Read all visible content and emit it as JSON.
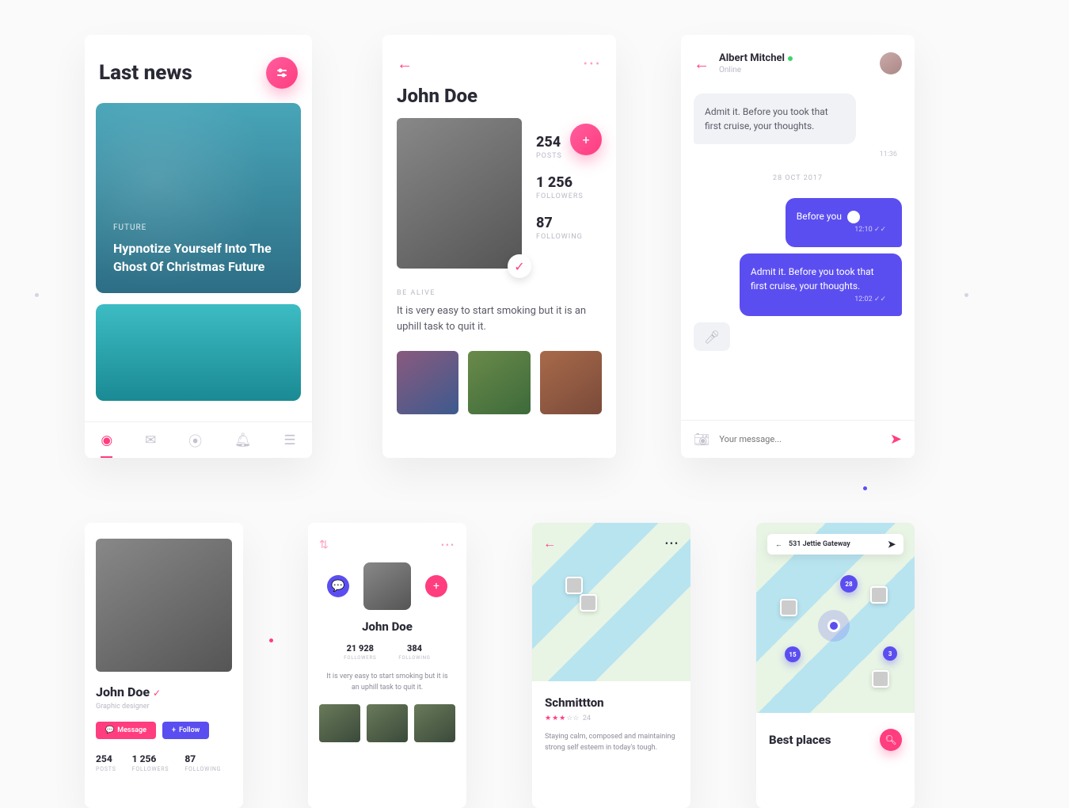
{
  "s1": {
    "title": "Last news",
    "feature": {
      "category": "FUTURE",
      "title": "Hypnotize Yourself Into The Ghost Of Christmas Future"
    }
  },
  "s2": {
    "name": "John Doe",
    "stats": [
      {
        "n": "254",
        "l": "POSTS"
      },
      {
        "n": "1 256",
        "l": "FOLLOWERS"
      },
      {
        "n": "87",
        "l": "FOLLOWING"
      }
    ],
    "bio_kicker": "BE ALIVE",
    "bio": "It is very easy to start smoking but it is an uphill task to quit it."
  },
  "s3": {
    "name": "Albert Mitchel",
    "status": "Online",
    "msg_in": "Admit it. Before you took that first cruise, your thoughts.",
    "msg_in_time": "11:36",
    "date": "28 OCT 2017",
    "msg_out1": "Before you",
    "msg_out1_time": "12:10",
    "msg_out2": "Admit it. Before you took that first cruise, your thoughts.",
    "msg_out2_time": "12:02",
    "placeholder": "Your message..."
  },
  "s4": {
    "name": "John Doe",
    "role": "Graphic designer",
    "btn_msg": "Message",
    "btn_follow": "Follow",
    "stats": [
      {
        "n": "254",
        "l": "POSTS"
      },
      {
        "n": "1 256",
        "l": "FOLLOWERS"
      },
      {
        "n": "87",
        "l": "FOLLOWING"
      }
    ]
  },
  "s5": {
    "name": "John Doe",
    "stats": [
      {
        "n": "21 928",
        "l": "FOLLOWERS"
      },
      {
        "n": "384",
        "l": "FOLLOWING"
      }
    ],
    "bio": "It is very easy to start smoking but it is an uphill task to quit it."
  },
  "s6": {
    "name": "Schmittton",
    "rating_count": "24",
    "desc": "Staying calm, composed and maintaining strong self esteem in today's tough."
  },
  "s7": {
    "address": "531 Jettie Gateway",
    "title": "Best places",
    "pins": [
      "28",
      "15",
      "3"
    ]
  }
}
